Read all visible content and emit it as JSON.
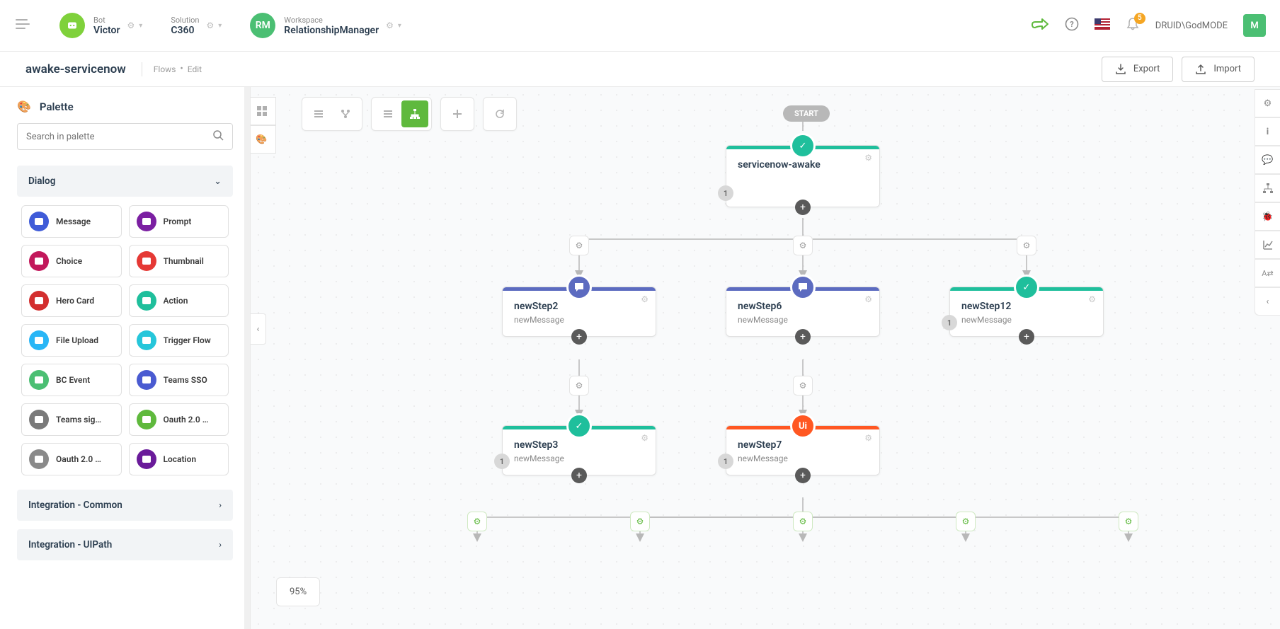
{
  "topbar": {
    "bot_label": "Bot",
    "bot_value": "Victor",
    "solution_label": "Solution",
    "solution_value": "C360",
    "workspace_label": "Workspace",
    "workspace_value": "RelationshipManager",
    "workspace_avatar": "RM",
    "notif_count": "5",
    "user_name": "DRUID\\GodMODE",
    "user_avatar": "M"
  },
  "breadcrumb": {
    "title": "awake-servicenow",
    "link1": "Flows",
    "link2": "Edit",
    "export": "Export",
    "import": "Import"
  },
  "palette": {
    "title": "Palette",
    "search_placeholder": "Search in palette",
    "sections": {
      "dialog": "Dialog",
      "integration_common": "Integration - Common",
      "integration_uipath": "Integration - UIPath"
    },
    "items": [
      {
        "label": "Message",
        "color": "#3f5bd8"
      },
      {
        "label": "Prompt",
        "color": "#7b1fa2"
      },
      {
        "label": "Choice",
        "color": "#c2185b"
      },
      {
        "label": "Thumbnail",
        "color": "#e53935"
      },
      {
        "label": "Hero Card",
        "color": "#d32f2f"
      },
      {
        "label": "Action",
        "color": "#1fbf9c"
      },
      {
        "label": "File Upload",
        "color": "#29b6f6"
      },
      {
        "label": "Trigger Flow",
        "color": "#26c6da"
      },
      {
        "label": "BC Event",
        "color": "#4bbf73"
      },
      {
        "label": "Teams SSO",
        "color": "#4a5bd1"
      },
      {
        "label": "Teams sig…",
        "color": "#7a7a7a"
      },
      {
        "label": "Oauth 2.0 …",
        "color": "#5fb93d"
      },
      {
        "label": "Oauth 2.0 …",
        "color": "#8a8a8a"
      },
      {
        "label": "Location",
        "color": "#6a1b9a"
      }
    ]
  },
  "canvas": {
    "zoom": "95%",
    "start": "START",
    "nodes": {
      "root": {
        "title": "servicenow-awake",
        "accent": "#1fbf9c",
        "badge": "1"
      },
      "s2": {
        "title": "newStep2",
        "sub": "newMessage",
        "accent": "#5c6bc0"
      },
      "s6": {
        "title": "newStep6",
        "sub": "newMessage",
        "accent": "#5c6bc0"
      },
      "s12": {
        "title": "newStep12",
        "sub": "newMessage",
        "accent": "#1fbf9c",
        "badge": "1"
      },
      "s3": {
        "title": "newStep3",
        "sub": "newMessage",
        "accent": "#1fbf9c",
        "badge": "1"
      },
      "s7": {
        "title": "newStep7",
        "sub": "newMessage",
        "accent": "#ff5722",
        "badge": "1"
      }
    }
  }
}
